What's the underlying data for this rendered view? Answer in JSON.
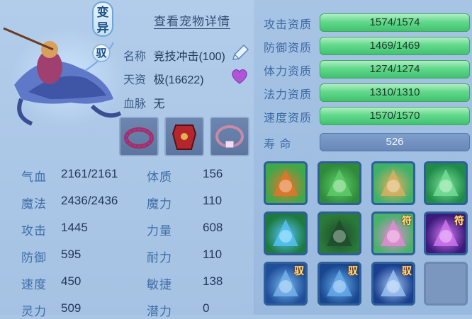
{
  "header": {
    "mutant_badge": "变异",
    "ride_badge": "驭",
    "detail_link": "查看宠物详情"
  },
  "info": {
    "name_label": "名称",
    "name_value": "竞技冲击(100)",
    "talent_label": "天资",
    "talent_value": "极(16622)",
    "bloodline_label": "血脉",
    "bloodline_value": "无"
  },
  "equipment": [
    "necklace-red-purple",
    "armor-red",
    "necklace-pink"
  ],
  "stats": [
    {
      "label": "气血",
      "value": "2161/2161",
      "label2": "体质",
      "value2": "156"
    },
    {
      "label": "魔法",
      "value": "2436/2436",
      "label2": "魔力",
      "value2": "110"
    },
    {
      "label": "攻击",
      "value": "1445",
      "label2": "力量",
      "value2": "608"
    },
    {
      "label": "防御",
      "value": "595",
      "label2": "耐力",
      "value2": "110"
    },
    {
      "label": "速度",
      "value": "450",
      "label2": "敏捷",
      "value2": "138"
    },
    {
      "label": "灵力",
      "value": "509",
      "label2": "潜力",
      "value2": "0"
    }
  ],
  "aptitudes": [
    {
      "label": "攻击资质",
      "value": "1574/1574",
      "fill": 1.0
    },
    {
      "label": "防御资质",
      "value": "1469/1469",
      "fill": 1.0
    },
    {
      "label": "体力资质",
      "value": "1274/1274",
      "fill": 1.0
    },
    {
      "label": "法力资质",
      "value": "1310/1310",
      "fill": 1.0
    },
    {
      "label": "速度资质",
      "value": "1570/1570",
      "fill": 1.0
    }
  ],
  "life": {
    "label": "寿  命",
    "value": "526"
  },
  "skills": [
    {
      "icon": "flame-sword-icon",
      "tag": ""
    },
    {
      "icon": "warrior-icon",
      "tag": ""
    },
    {
      "icon": "boot-icon",
      "tag": ""
    },
    {
      "icon": "green-slash-icon",
      "tag": ""
    },
    {
      "icon": "blue-flame-icon",
      "tag": ""
    },
    {
      "icon": "giant-icon",
      "tag": ""
    },
    {
      "icon": "heart-rune-icon",
      "tag": "符"
    },
    {
      "icon": "purple-burst-icon",
      "tag": "符"
    },
    {
      "icon": "shield-icon",
      "tag": "驭"
    },
    {
      "icon": "blue-wave-icon",
      "tag": "驭"
    },
    {
      "icon": "ice-crystal-icon",
      "tag": "驭"
    },
    {
      "icon": "empty-slot",
      "tag": ""
    }
  ]
}
